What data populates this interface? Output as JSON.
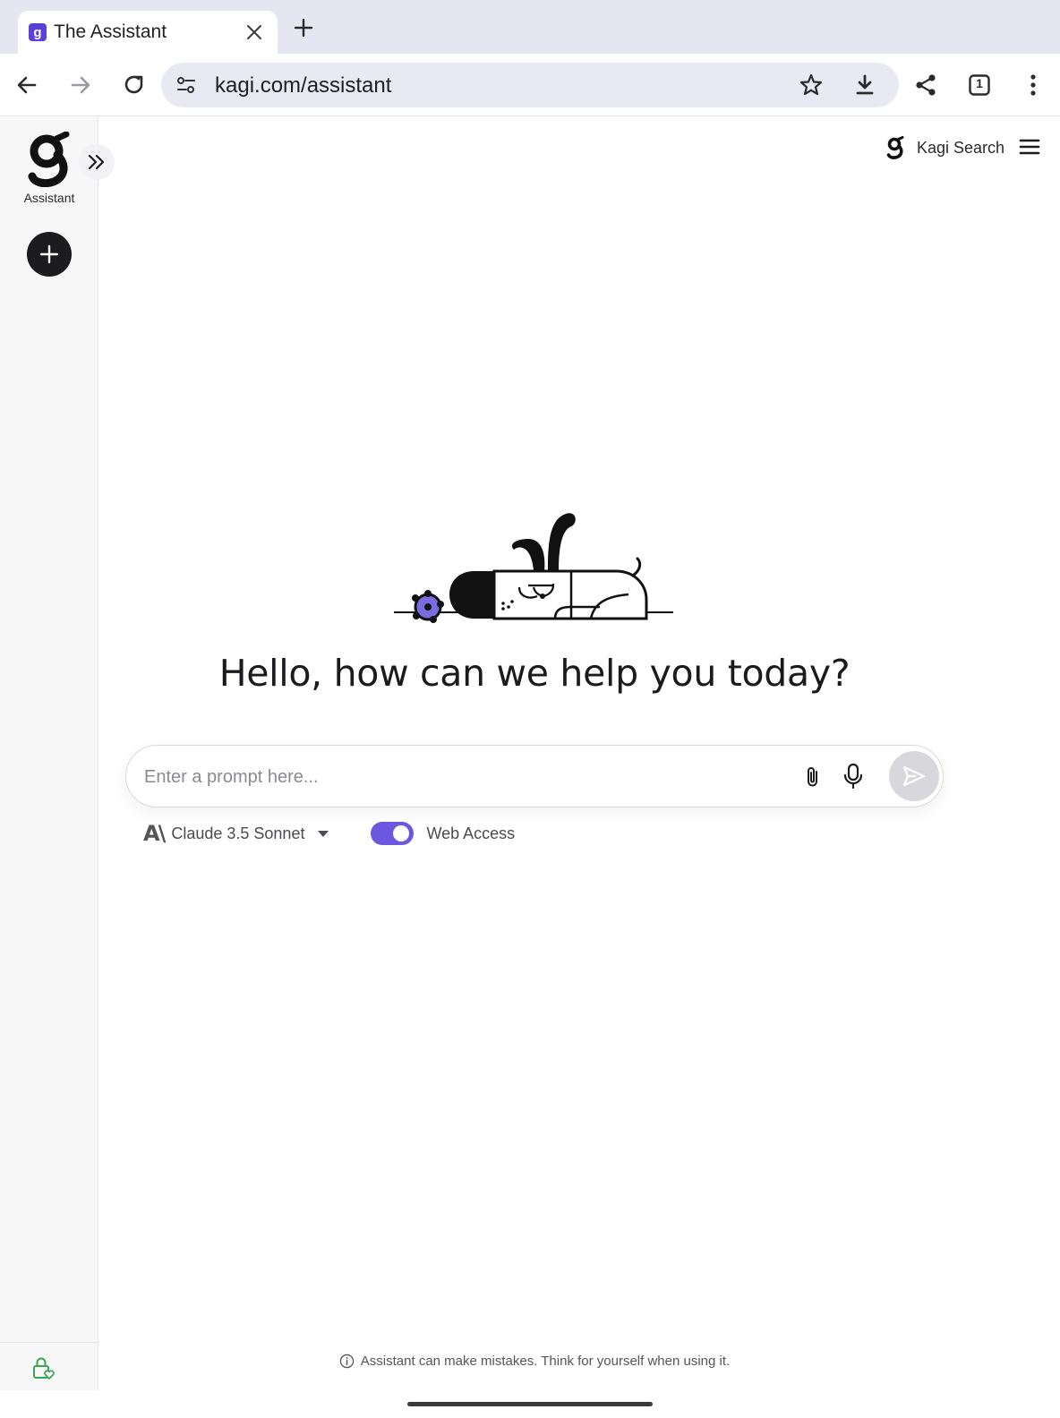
{
  "browser": {
    "tab": {
      "favicon": "g",
      "title": "The Assistant",
      "close_icon": "close-icon"
    },
    "new_tab_icon": "plus-icon",
    "toolbar": {
      "back_icon": "arrow-left-icon",
      "forward_icon": "arrow-right-icon",
      "reload_icon": "reload-icon",
      "site_settings_icon": "tune-icon",
      "url": "kagi.com/assistant",
      "bookmark_icon": "star-icon",
      "download_icon": "download-icon",
      "share_icon": "share-icon",
      "tab_count": "1",
      "menu_icon": "more-vertical-icon"
    }
  },
  "sidebar": {
    "logo_label": "Assistant",
    "expand_icon": "double-chevron-right-icon",
    "new_chat_icon": "plus-icon",
    "privacy_icon": "lock-heart-icon"
  },
  "header": {
    "search_link_label": "Kagi Search",
    "menu_icon": "hamburger-icon"
  },
  "main": {
    "headline": "Hello, how can we help you today?",
    "prompt": {
      "placeholder": "Enter a prompt here...",
      "attach_icon": "paperclip-icon",
      "mic_icon": "microphone-icon",
      "send_icon": "send-icon"
    },
    "model": {
      "icon_text": "A\\",
      "label": "Claude 3.5 Sonnet",
      "caret_icon": "caret-down-icon"
    },
    "web_access": {
      "label": "Web Access",
      "enabled": true
    },
    "disclaimer": "Assistant can make mistakes. Think for yourself when using it."
  },
  "colors": {
    "accent": "#6b57e0",
    "favicon": "#5a3fd9",
    "sidebar_bg": "#f7f7f8",
    "tabstrip_bg": "#e6e6f2",
    "privacy_icon": "#3aa655"
  }
}
